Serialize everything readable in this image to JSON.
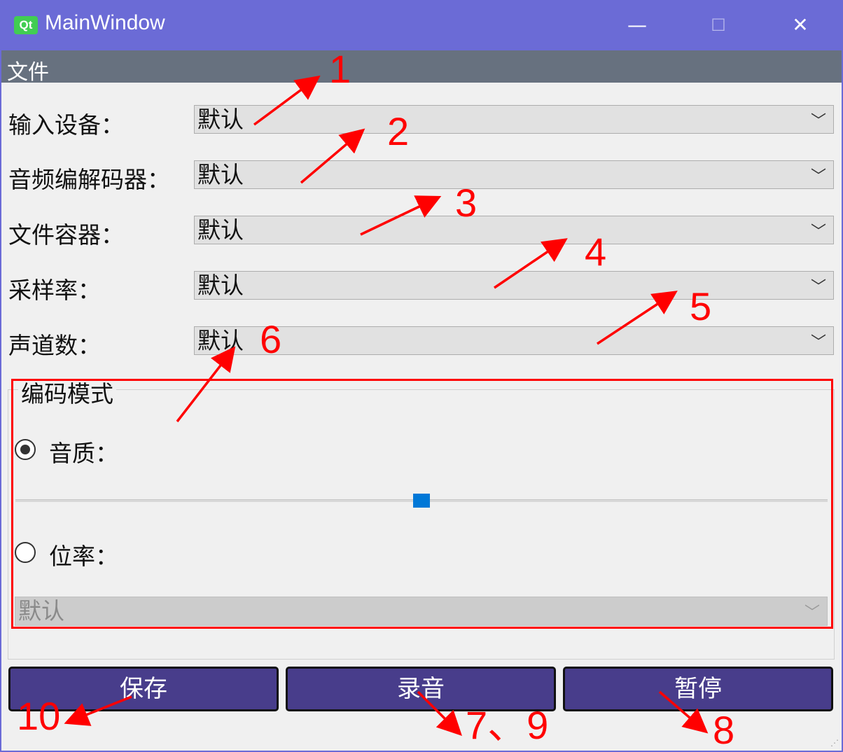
{
  "window": {
    "logo": "Qt",
    "title": "MainWindow",
    "minimize": "—",
    "maximize": "☐",
    "close": "✕"
  },
  "menu": {
    "file": "文件"
  },
  "form": {
    "input_device": {
      "label": "输入设备：",
      "value": "默认"
    },
    "audio_codec": {
      "label": "音频编解码器：",
      "value": "默认"
    },
    "file_container": {
      "label": "文件容器：",
      "value": "默认"
    },
    "sample_rate": {
      "label": "采样率：",
      "value": "默认"
    },
    "channels": {
      "label": "声道数：",
      "value": "默认"
    }
  },
  "encoding": {
    "title": "编码模式",
    "quality_label": "音质：",
    "quality_checked": true,
    "quality_slider_fraction": 0.5,
    "bitrate_label": "位率：",
    "bitrate_checked": false,
    "bitrate_value": "默认"
  },
  "buttons": {
    "save": "保存",
    "record": "录音",
    "pause": "暂停"
  },
  "annotations": {
    "color": "#ff0000",
    "labels": [
      "1",
      "2",
      "3",
      "4",
      "5",
      "6",
      "7、9",
      "8",
      "10"
    ]
  },
  "colors": {
    "titlebar": "#6b6bd6",
    "menubar": "#67717f",
    "button": "#483d8b",
    "slider": "#0078d7"
  }
}
